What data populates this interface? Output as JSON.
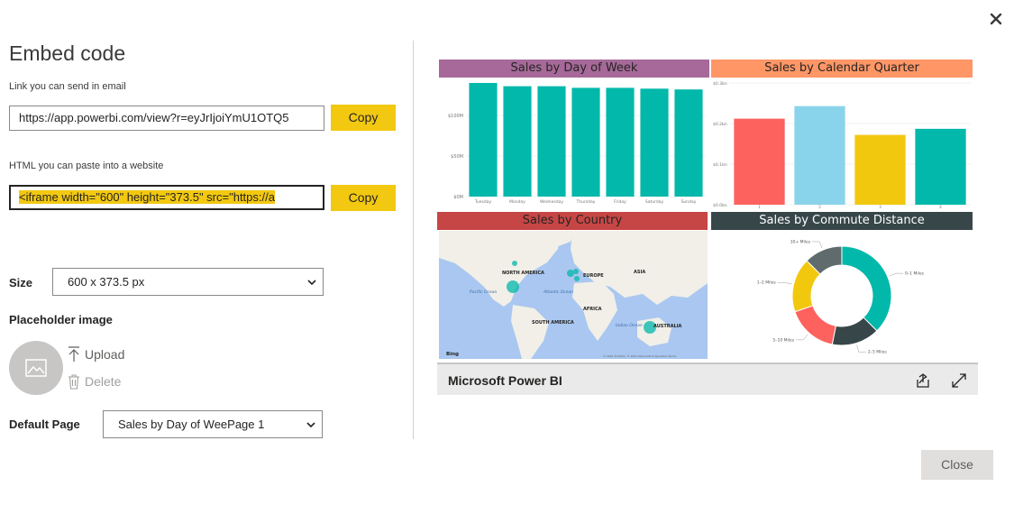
{
  "dialog": {
    "title": "Embed code",
    "close_button_label": "Close"
  },
  "link_section": {
    "label": "Link you can send in email",
    "url": "https://app.powerbi.com/view?r=eyJrIjoiYmU1OTQ5",
    "copy_label": "Copy"
  },
  "html_section": {
    "label": "HTML you can paste into a website",
    "code": "<iframe width=\"600\" height=\"373.5\" src=\"https://a",
    "copy_label": "Copy"
  },
  "size": {
    "label": "Size",
    "value": "600 x 373.5 px"
  },
  "placeholder": {
    "label": "Placeholder image",
    "upload_label": "Upload",
    "delete_label": "Delete"
  },
  "default_page": {
    "label": "Default Page",
    "value": "Sales by Day of WeePage 1"
  },
  "preview": {
    "footer_title": "Microsoft Power BI",
    "map": {
      "title": "Sales by Country",
      "labels": [
        "NORTH AMERICA",
        "EUROPE",
        "ASIA",
        "SOUTH AMERICA",
        "AFRICA",
        "AUSTRALIA",
        "Pacific Ocean",
        "Atlantic Ocean",
        "Indian Ocean"
      ],
      "brand": "Bing",
      "attribution": "© 2021 TomTom, © 2021 Microsoft Corporation  Terms"
    }
  },
  "colors": {
    "accent": "#f2c811",
    "teal": "#01b8aa",
    "red": "#fd625e",
    "sky": "#8ad4eb",
    "yellow": "#f2c80f",
    "slate": "#374649",
    "grey": "#5f6b6d",
    "purple_header": "#a66999",
    "orange_header": "#fe9666",
    "red_header": "#c64645",
    "dark_header": "#374649"
  },
  "chart_data": [
    {
      "type": "bar",
      "title": "Sales by Day of Week",
      "categories": [
        "Tuesday",
        "Monday",
        "Wednesday",
        "Thursday",
        "Friday",
        "Saturday",
        "Sunday"
      ],
      "values": [
        140,
        136,
        136,
        134,
        134,
        133,
        132
      ],
      "ytick_labels": [
        "$0M",
        "$50M",
        "$100M"
      ],
      "yticks": [
        0,
        50,
        100
      ],
      "ylim": [
        0,
        140
      ]
    },
    {
      "type": "bar",
      "title": "Sales by Calendar Quarter",
      "categories": [
        "1",
        "2",
        "3",
        "4"
      ],
      "values": [
        0.212,
        0.243,
        0.172,
        0.187
      ],
      "ytick_labels": [
        "$0.0bn",
        "$0.1bn",
        "$0.2bn",
        "$0.3bn"
      ],
      "yticks": [
        0,
        0.1,
        0.2,
        0.3
      ],
      "ylim": [
        0,
        0.3
      ]
    },
    {
      "type": "pie",
      "title": "Sales by Commute Distance",
      "categories": [
        "0–1 Miles",
        "2–5 Miles",
        "5–10 Miles",
        "1–2 Miles",
        "10+ Miles"
      ],
      "values": [
        36,
        15,
        16,
        17,
        12
      ]
    }
  ]
}
